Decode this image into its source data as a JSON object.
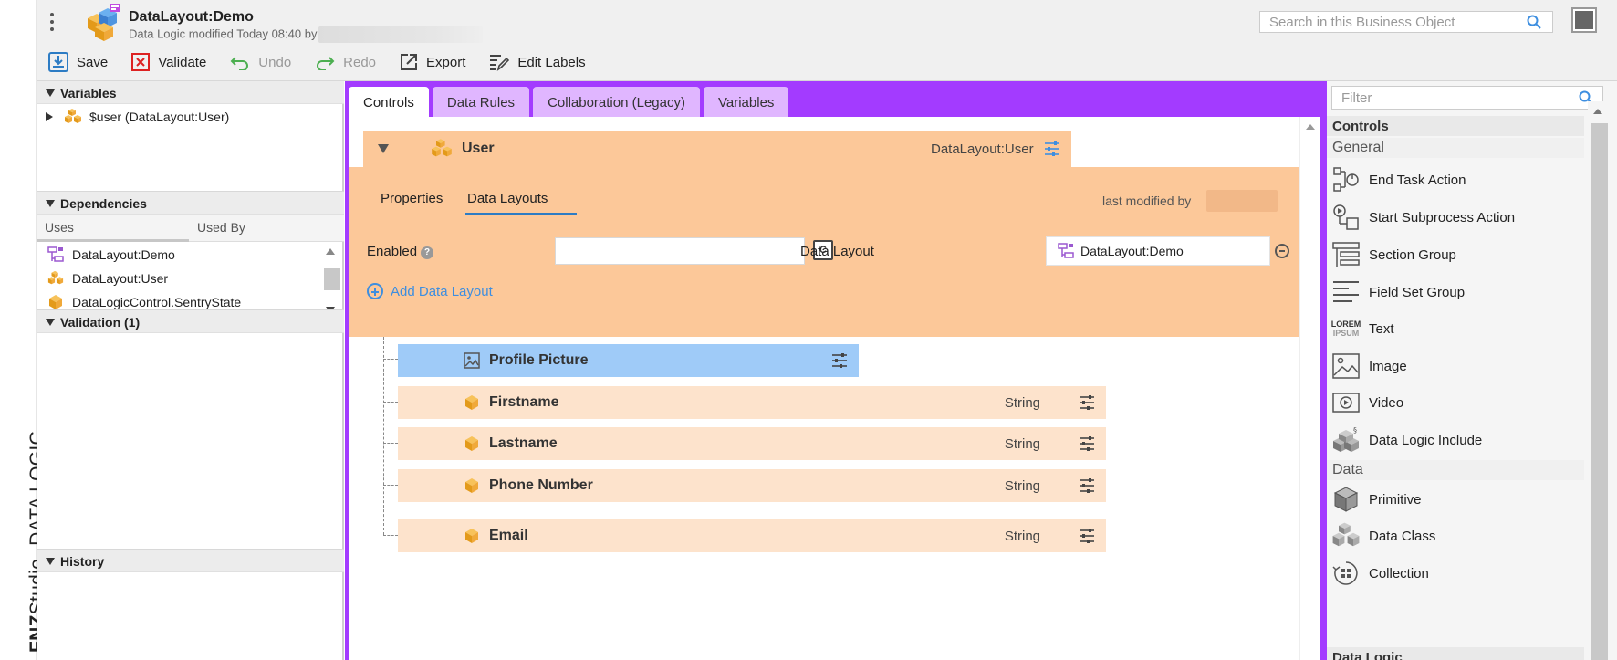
{
  "app": {
    "brand_bold": "FNZ",
    "brand_light": "Studio",
    "product": "DATA LOGIC",
    "title": "DataLayout:Demo",
    "subtitle": "Data Logic modified Today 08:40 by"
  },
  "search": {
    "placeholder": "Search in this Business Object"
  },
  "toolbar": {
    "save": "Save",
    "validate": "Validate",
    "undo": "Undo",
    "redo": "Redo",
    "export": "Export",
    "edit_labels": "Edit Labels"
  },
  "left": {
    "variables_title": "Variables",
    "variable_item": "$user (DataLayout:User)",
    "dependencies_title": "Dependencies",
    "uses_tab": "Uses",
    "usedby_tab": "Used By",
    "deps": [
      "DataLayout:Demo",
      "DataLayout:User",
      "DataLogicControl.SentryState"
    ],
    "validation_title": "Validation (1)",
    "history_title": "History"
  },
  "tabs": [
    "Controls",
    "Data Rules",
    "Collaboration (Legacy)",
    "Variables"
  ],
  "editor": {
    "object_name": "User",
    "object_type": "DataLayout:User",
    "subtabs": [
      "Properties",
      "Data Layouts"
    ],
    "last_modified": "last modified by",
    "enabled_label": "Enabled",
    "help_glyph": "?",
    "c_glyph": "C",
    "data_layout_label": "Data Layout",
    "data_layout_value": "DataLayout:Demo",
    "add_data_layout": "Add Data Layout",
    "fields": [
      {
        "name": "Profile Picture",
        "type": ""
      },
      {
        "name": "Firstname",
        "type": "String"
      },
      {
        "name": "Lastname",
        "type": "String"
      },
      {
        "name": "Phone Number",
        "type": "String"
      },
      {
        "name": "Email",
        "type": "String"
      }
    ]
  },
  "right": {
    "filter_placeholder": "Filter",
    "controls_title": "Controls",
    "general_title": "General",
    "general_items": [
      "End Task Action",
      "Start Subprocess Action",
      "Section Group",
      "Field Set Group",
      "Text",
      "Image",
      "Video",
      "Data Logic Include"
    ],
    "data_title": "Data",
    "data_items": [
      "Primitive",
      "Data Class",
      "Collection"
    ],
    "next_section": "Data Logic",
    "lorem_line1": "LOREM",
    "lorem_line2": "IPSUM"
  },
  "colors": {
    "accent_purple": "#a33bff",
    "tab_inactive": "#e0b6ff",
    "orange_panel": "#fcc899",
    "field_row": "#fde3cc",
    "selected_row": "#9fcbf8",
    "link_blue": "#3d8ee0"
  }
}
